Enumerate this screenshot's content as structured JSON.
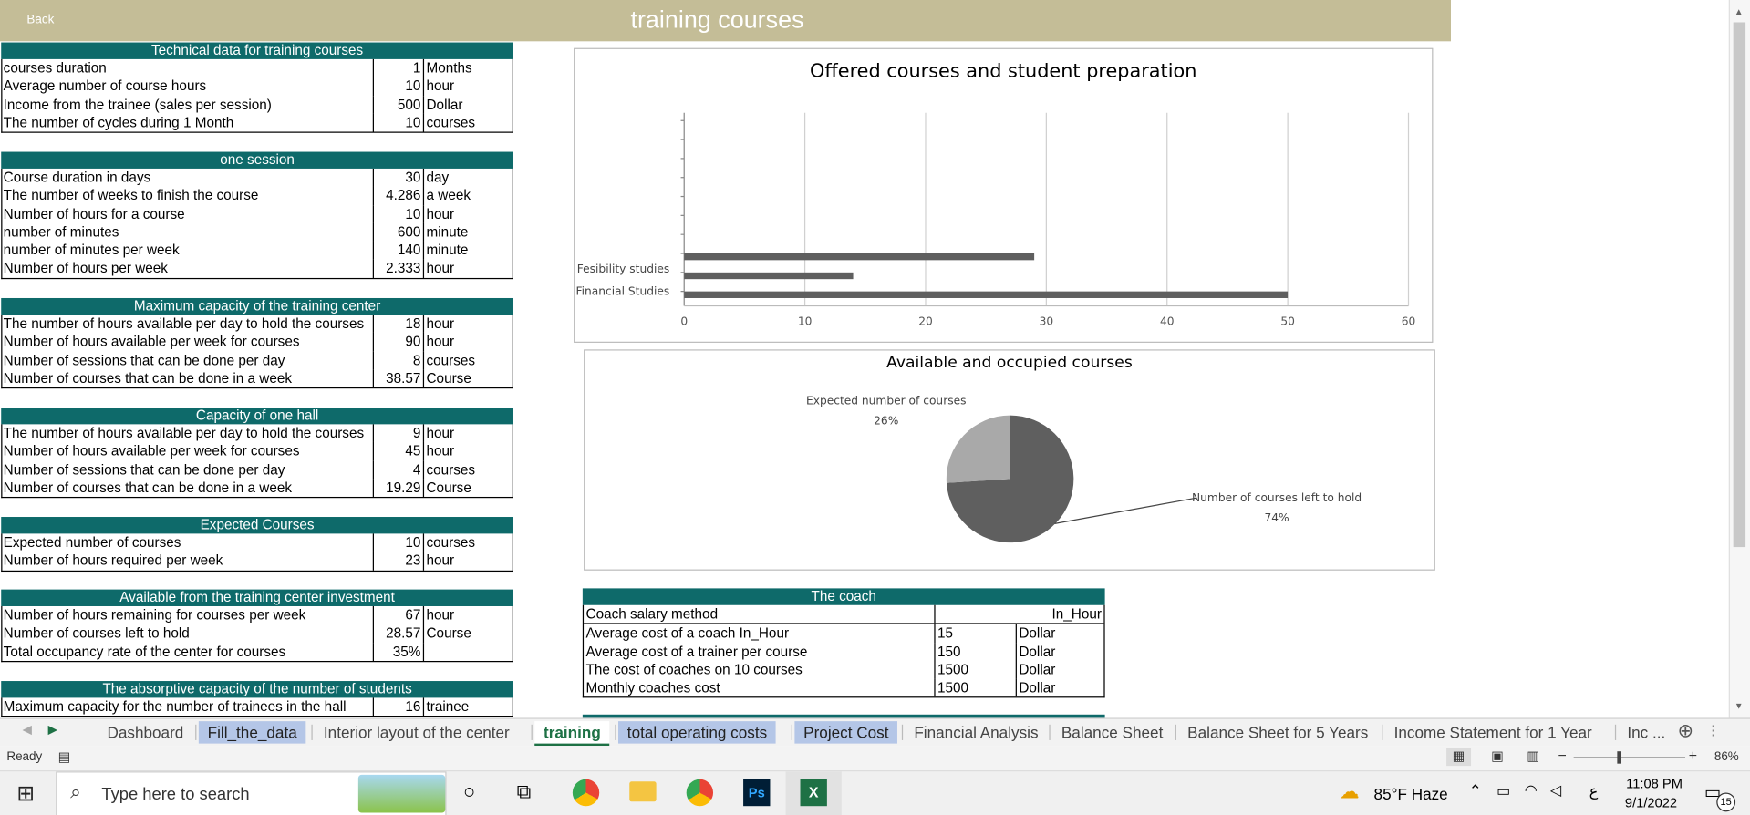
{
  "header": {
    "back_label": "Back",
    "title": "training courses"
  },
  "blocks": [
    {
      "title": "Technical data for training courses",
      "top": 37,
      "rows": [
        [
          " courses  duration",
          "1",
          "Months"
        ],
        [
          "Average number of course hours",
          "10",
          "hour"
        ],
        [
          "Income from the trainee (sales per session)",
          "500",
          "Dollar"
        ],
        [
          "The number of cycles during  1  Month",
          "10",
          "courses"
        ]
      ]
    },
    {
      "title": "one session",
      "top": 135,
      "rows": [
        [
          "Course duration in days",
          "30",
          "day"
        ],
        [
          "The number of weeks to finish the course",
          "4.286",
          "a week"
        ],
        [
          "Number of hours for a course",
          "10",
          "hour"
        ],
        [
          "number of minutes",
          "600",
          "minute"
        ],
        [
          "number of minutes per week",
          "140",
          "minute"
        ],
        [
          "Number of hours per week",
          "2.333",
          "hour"
        ]
      ]
    },
    {
      "title": "Maximum capacity of the training center",
      "top": 266,
      "rows": [
        [
          "The number of hours available per day to hold the courses",
          "18",
          "hour"
        ],
        [
          "Number of hours available per week for courses",
          "90",
          "hour"
        ],
        [
          "Number of sessions that can be done per day",
          "8",
          "courses"
        ],
        [
          "Number of courses that can be done in a week",
          "38.57",
          "Course"
        ]
      ]
    },
    {
      "title": "Capacity of one hall",
      "top": 364,
      "rows": [
        [
          "The number of hours available per day to hold the courses",
          "9",
          "hour"
        ],
        [
          "Number of hours available per week for courses",
          "45",
          "hour"
        ],
        [
          "Number of sessions that can be done per day",
          "4",
          "courses"
        ],
        [
          "Number of courses that can be done in a week",
          "19.29",
          "Course"
        ]
      ]
    },
    {
      "title": "Expected Courses",
      "top": 462,
      "rows": [
        [
          "Expected number of courses",
          "10",
          "courses"
        ],
        [
          "Number of hours required per week",
          "23",
          "hour"
        ]
      ]
    },
    {
      "title": "Available from the training center investment",
      "top": 527,
      "rows": [
        [
          "Number of hours remaining for courses per week",
          "67",
          "hour"
        ],
        [
          "Number of courses left to hold",
          "28.57",
          "Course"
        ],
        [
          "Total occupancy rate of the center for courses",
          "35%",
          ""
        ]
      ]
    },
    {
      "title": "The absorptive capacity of the number of students",
      "top": 609,
      "rows": [
        [
          "Maximum capacity for the number of trainees in the hall",
          "16",
          "trainee"
        ]
      ]
    }
  ],
  "chart_data": [
    {
      "type": "bar",
      "title": "Offered courses and student preparation",
      "categories": [
        "Financial Studies",
        "Fesibility studies",
        ""
      ],
      "values": [
        50,
        14,
        29
      ],
      "xlim": [
        0,
        60
      ],
      "xticks": [
        "0",
        "10",
        "20",
        "30",
        "40",
        "50",
        "60"
      ],
      "grid": true,
      "bar_color": "#5f5f5f"
    },
    {
      "type": "pie",
      "title": "Available and occupied courses",
      "labels": [
        "Expected number of courses",
        "Number of courses left to hold"
      ],
      "values": [
        26,
        74
      ],
      "percent_labels": [
        "26%",
        "74%"
      ],
      "colors": [
        "#a9a9a9",
        "#5f5f5f"
      ]
    }
  ],
  "coach": {
    "title": "The coach",
    "rows": [
      [
        "Coach salary method",
        "",
        "In_Hour"
      ],
      [
        "Average cost of a coach  In_Hour",
        "15",
        "Dollar"
      ],
      [
        "Average cost of a trainer per course",
        "150",
        "Dollar"
      ],
      [
        "The cost of coaches on  10  courses",
        "1500",
        "Dollar"
      ],
      [
        "Monthly coaches cost",
        "1500",
        "Dollar"
      ]
    ]
  },
  "tabs": [
    {
      "label": "Dashboard",
      "state": ""
    },
    {
      "label": "Fill_the_data",
      "state": "hl"
    },
    {
      "label": "Interior layout of the center",
      "state": ""
    },
    {
      "label": "training",
      "state": "active"
    },
    {
      "label": "total operating costs",
      "state": "hl"
    },
    {
      "label": "Project Cost",
      "state": "hl"
    },
    {
      "label": "Financial Analysis",
      "state": ""
    },
    {
      "label": "Balance Sheet",
      "state": ""
    },
    {
      "label": "Balance Sheet for 5 Years",
      "state": ""
    },
    {
      "label": "Income Statement for 1 Year",
      "state": ""
    },
    {
      "label": "Inc ...",
      "state": ""
    }
  ],
  "status": {
    "ready": "Ready",
    "zoom": "86%"
  },
  "taskbar": {
    "search_placeholder": "Type here to search",
    "weather": "85°F  Haze",
    "time": "11:08 PM",
    "date": "9/1/2022",
    "notifications": "15",
    "lang": "ع"
  }
}
